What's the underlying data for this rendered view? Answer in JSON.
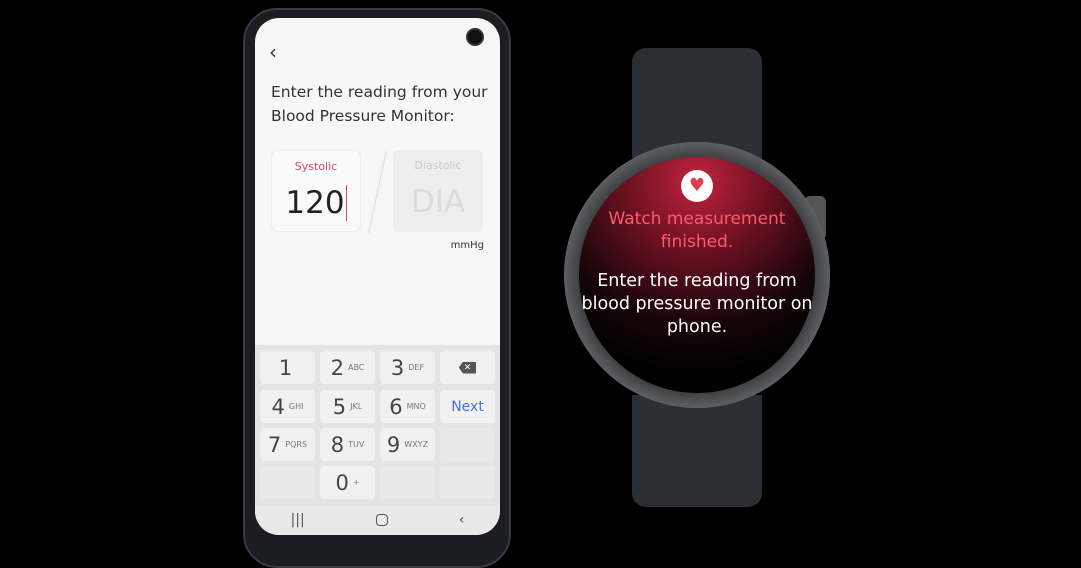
{
  "phone": {
    "back_icon": "chevron-left-icon",
    "title": "Enter the reading from your Blood Pressure Monitor:",
    "systolic": {
      "label": "Systolic",
      "value": "120"
    },
    "diastolic": {
      "label": "Diastolic",
      "placeholder": "DIA"
    },
    "unit": "mmHg",
    "keys": [
      {
        "n": "1",
        "s": ""
      },
      {
        "n": "2",
        "s": "ABC"
      },
      {
        "n": "3",
        "s": "DEF"
      },
      {
        "n": "4",
        "s": "GHI"
      },
      {
        "n": "5",
        "s": "JKL"
      },
      {
        "n": "6",
        "s": "MNO"
      },
      {
        "n": "7",
        "s": "PQRS"
      },
      {
        "n": "8",
        "s": "TUV"
      },
      {
        "n": "9",
        "s": "WXYZ"
      },
      {
        "n": "0",
        "s": "+"
      }
    ],
    "next": "Next",
    "accent": "#d9486a",
    "next_color": "#4a6fd8"
  },
  "watch": {
    "status": "Watch measurement finished.",
    "message": "Enter the reading from blood pressure monitor on phone.",
    "icon": "heart-pulse-icon"
  }
}
